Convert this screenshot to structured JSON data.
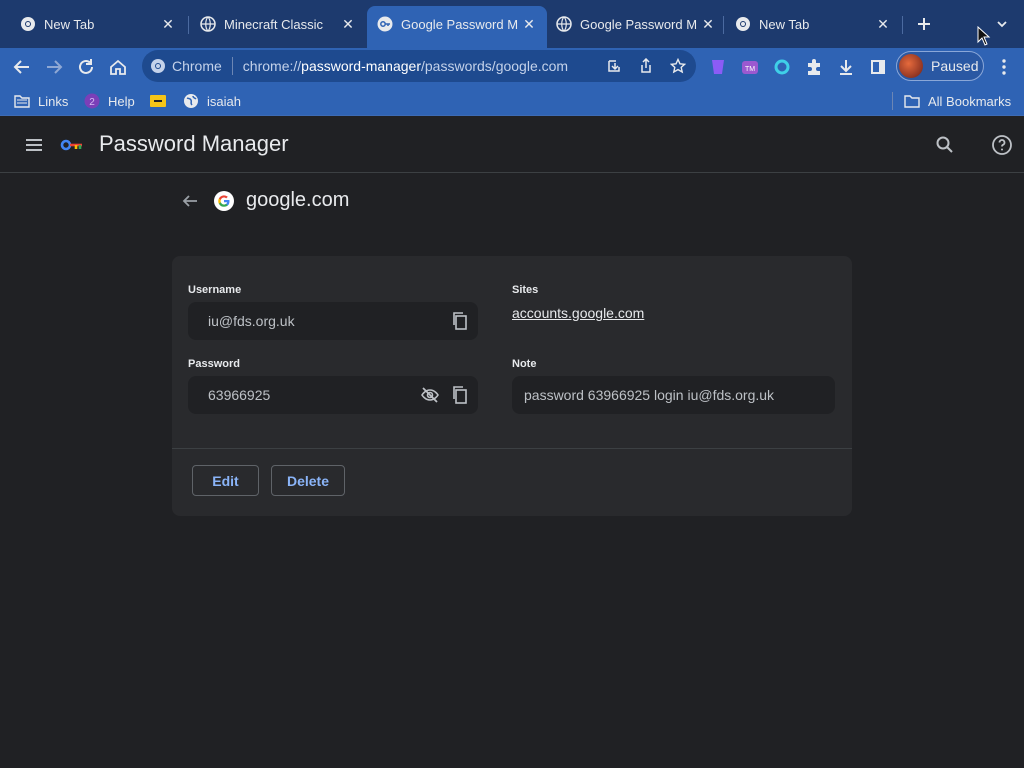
{
  "browser": {
    "tabs": [
      {
        "title": "New Tab",
        "icon": "chrome-icon",
        "active": false
      },
      {
        "title": "Minecraft Classic",
        "icon": "globe-icon",
        "active": false
      },
      {
        "title": "Google Password M",
        "icon": "password-manager-icon",
        "active": true
      },
      {
        "title": "Google Password M",
        "icon": "globe-icon",
        "active": false
      },
      {
        "title": "New Tab",
        "icon": "chrome-icon",
        "active": false
      }
    ],
    "close_glyph": "✕",
    "omnibox": {
      "chip_label": "Chrome",
      "url_prefix": "chrome://",
      "url_host": "password-manager",
      "url_path": "/passwords/google.com"
    },
    "profile_label": "Paused",
    "bookmarks": [
      {
        "label": "Links",
        "icon": "folder-icon"
      },
      {
        "label": "Help",
        "icon": "help-badge-icon"
      },
      {
        "label": "",
        "icon": "yellow-bookmark-icon"
      },
      {
        "label": "isaiah",
        "icon": "globe-icon"
      }
    ],
    "all_bookmarks_label": "All Bookmarks"
  },
  "app": {
    "title": "Password Manager"
  },
  "detail": {
    "site_title": "google.com",
    "username_label": "Username",
    "username_value": "iu@fds.org.uk",
    "password_label": "Password",
    "password_value": "63966925",
    "sites_label": "Sites",
    "site_link": "accounts.google.com",
    "note_label": "Note",
    "note_value": "password 63966925 login iu@fds.org.uk",
    "edit_label": "Edit",
    "delete_label": "Delete"
  },
  "colors": {
    "tabstrip": "#1d3a6e",
    "toolbar": "#2f63b4",
    "page_bg": "#202124",
    "card_bg": "#292a2d",
    "accent": "#8ab4f8"
  }
}
